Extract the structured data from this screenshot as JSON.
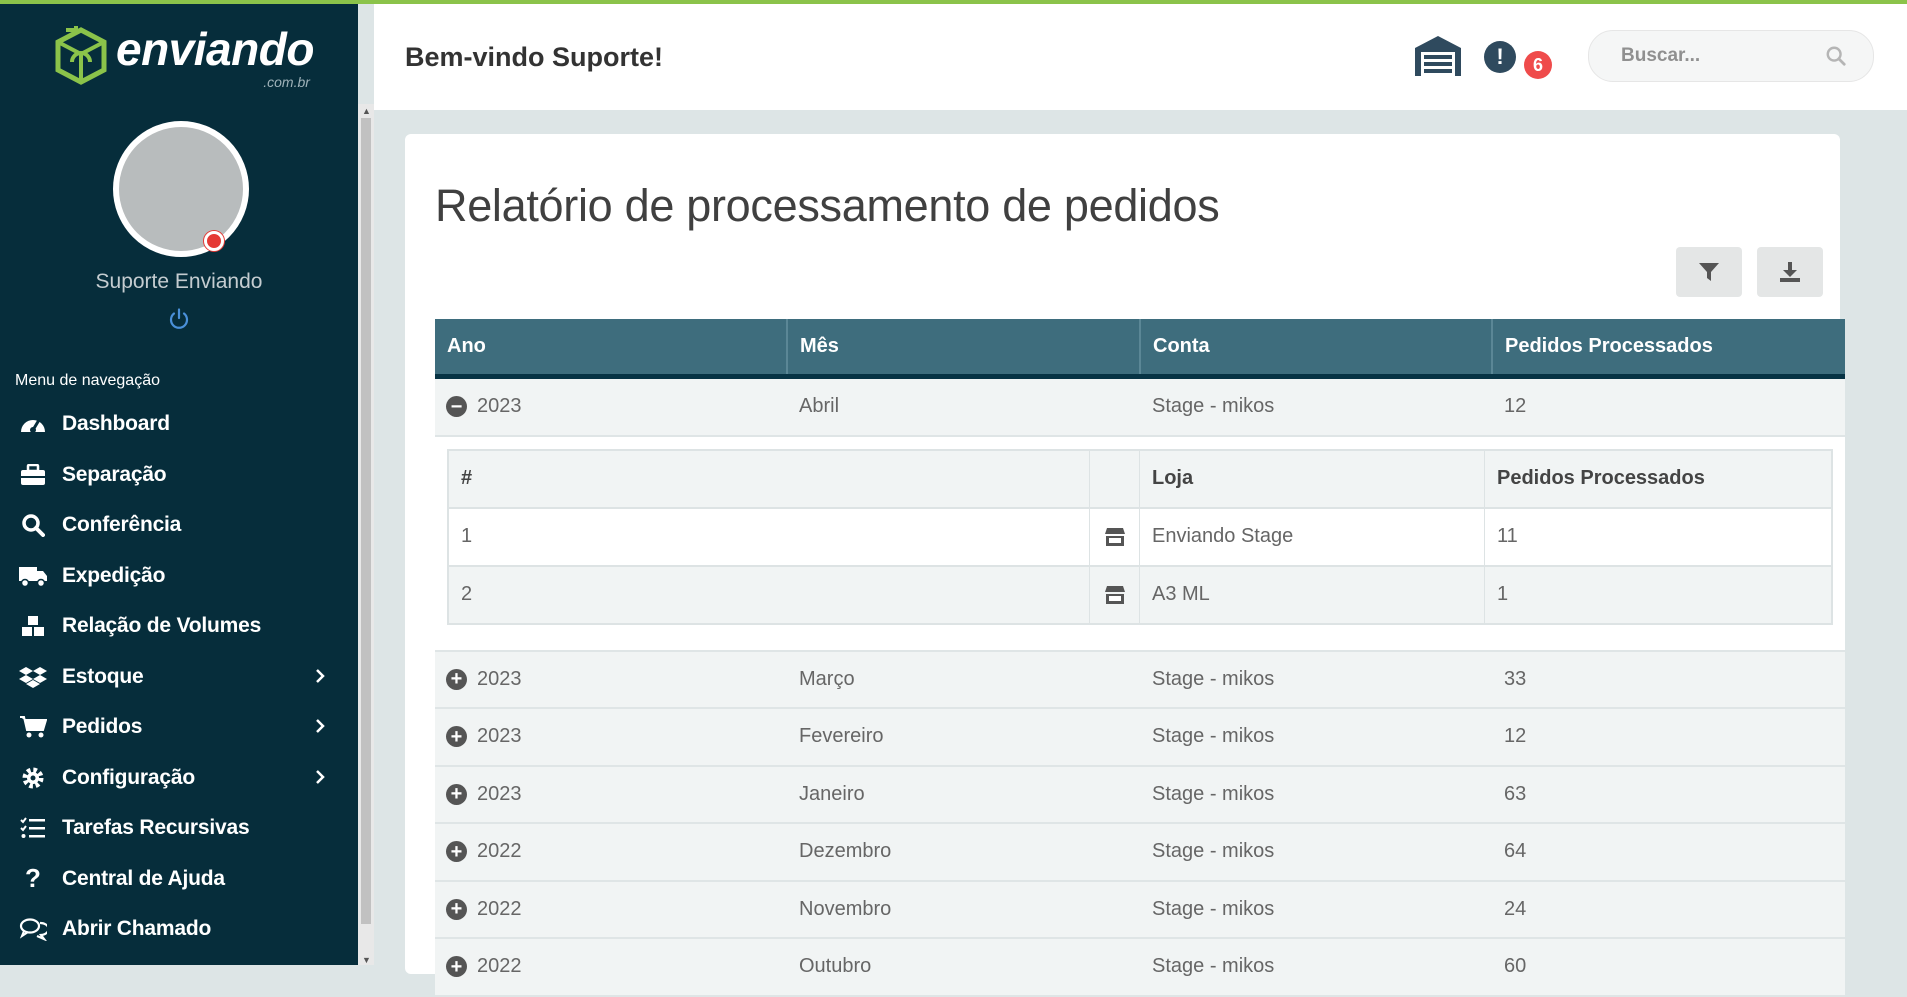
{
  "brand": {
    "name": "enviando",
    "suffix": ".com.br",
    "accent": "#8bc34a",
    "sidebar_bg": "#062d3b"
  },
  "user": {
    "name": "Suporte Enviando",
    "status": "offline"
  },
  "sidebar": {
    "menu_title": "Menu de navegação",
    "items": [
      {
        "label": "Dashboard",
        "icon": "tachometer-icon",
        "has_submenu": false
      },
      {
        "label": "Separação",
        "icon": "briefcase-icon",
        "has_submenu": false
      },
      {
        "label": "Conferência",
        "icon": "search-icon",
        "has_submenu": false
      },
      {
        "label": "Expedição",
        "icon": "truck-icon",
        "has_submenu": false
      },
      {
        "label": "Relação de Volumes",
        "icon": "cubes-icon",
        "has_submenu": false
      },
      {
        "label": "Estoque",
        "icon": "dropbox-icon",
        "has_submenu": true
      },
      {
        "label": "Pedidos",
        "icon": "shopping-cart-icon",
        "has_submenu": true
      },
      {
        "label": "Configuração",
        "icon": "gear-icon",
        "has_submenu": true
      },
      {
        "label": "Tarefas Recursivas",
        "icon": "tasks-icon",
        "has_submenu": false
      },
      {
        "label": "Central de Ajuda",
        "icon": "question-icon",
        "has_submenu": false
      },
      {
        "label": "Abrir Chamado",
        "icon": "comments-icon",
        "has_submenu": false
      }
    ]
  },
  "header": {
    "welcome": "Bem-vindo Suporte!",
    "notifications_count": "6",
    "search_placeholder": "Buscar..."
  },
  "page": {
    "title": "Relatório de processamento de pedidos",
    "columns": [
      "Ano",
      "Mês",
      "Conta",
      "Pedidos Processados"
    ],
    "expanded_row": {
      "year": "2023",
      "month": "Abril",
      "account": "Stage - mikos",
      "processed": "12"
    },
    "sub_columns": [
      "#",
      "",
      "Loja",
      "Pedidos Processados"
    ],
    "sub_rows": [
      {
        "n": "1",
        "store": "Enviando Stage",
        "processed": "11"
      },
      {
        "n": "2",
        "store": "A3 ML",
        "processed": "1"
      }
    ],
    "rows": [
      {
        "year": "2023",
        "month": "Março",
        "account": "Stage - mikos",
        "processed": "33"
      },
      {
        "year": "2023",
        "month": "Fevereiro",
        "account": "Stage - mikos",
        "processed": "12"
      },
      {
        "year": "2023",
        "month": "Janeiro",
        "account": "Stage - mikos",
        "processed": "63"
      },
      {
        "year": "2022",
        "month": "Dezembro",
        "account": "Stage - mikos",
        "processed": "64"
      },
      {
        "year": "2022",
        "month": "Novembro",
        "account": "Stage - mikos",
        "processed": "24"
      },
      {
        "year": "2022",
        "month": "Outubro",
        "account": "Stage - mikos",
        "processed": "60"
      }
    ]
  }
}
